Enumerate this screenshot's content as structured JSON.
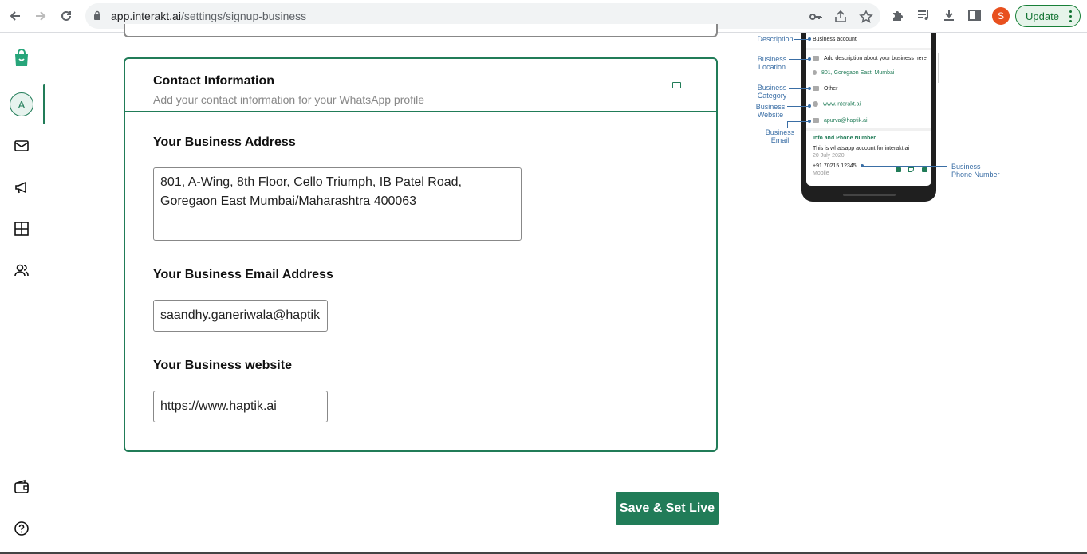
{
  "browser": {
    "url_host": "app.interakt.ai",
    "url_path": "/settings/signup-business",
    "profile_initial": "S",
    "update_label": "Update"
  },
  "sidebar": {
    "avatar_initial": "A",
    "items": [
      {
        "icon": "logo-bag-icon"
      },
      {
        "icon": "avatar-icon"
      },
      {
        "icon": "inbox-icon"
      },
      {
        "icon": "campaign-megaphone-icon"
      },
      {
        "icon": "grid-icon"
      },
      {
        "icon": "users-icon"
      },
      {
        "icon": "wallet-icon"
      },
      {
        "icon": "help-icon"
      }
    ]
  },
  "contact_card": {
    "title": "Contact Information",
    "subtitle": "Add your contact information for your WhatsApp profile",
    "address_label": "Your Business Address",
    "address_value": "801, A-Wing, 8th Floor, Cello Triumph, IB Patel Road, Goregaon East Mumbai/Maharashtra 400063",
    "email_label": "Your Business Email Address",
    "email_value": "saandhy.ganeriwala@haptik.",
    "website_label": "Your Business website",
    "website_value": "https://www.haptik.ai"
  },
  "actions": {
    "save_label": "Save & Set Live"
  },
  "preview": {
    "business_account": "Business account",
    "description": "Add description about your business here",
    "location": "801, Goregaon East, Mumbai",
    "category": "Other",
    "website": "www.interakt.ai",
    "email": "apurva@haptik.ai",
    "info_heading": "Info and Phone Number",
    "info_text": "This is whatsapp account for interakt.ai",
    "info_date": "20 July 2020",
    "phone": "+91 70215 12345",
    "phone_type": "Mobile",
    "annotations": {
      "description": "Description",
      "location": "Business\nLocation",
      "category": "Business\nCategory",
      "website": "Business\nWebsite",
      "email": "Business\nEmail",
      "phone": "Business\nPhone Number"
    }
  },
  "colors": {
    "brand_green": "#217c58",
    "annotation_blue": "#3a6ea5"
  }
}
